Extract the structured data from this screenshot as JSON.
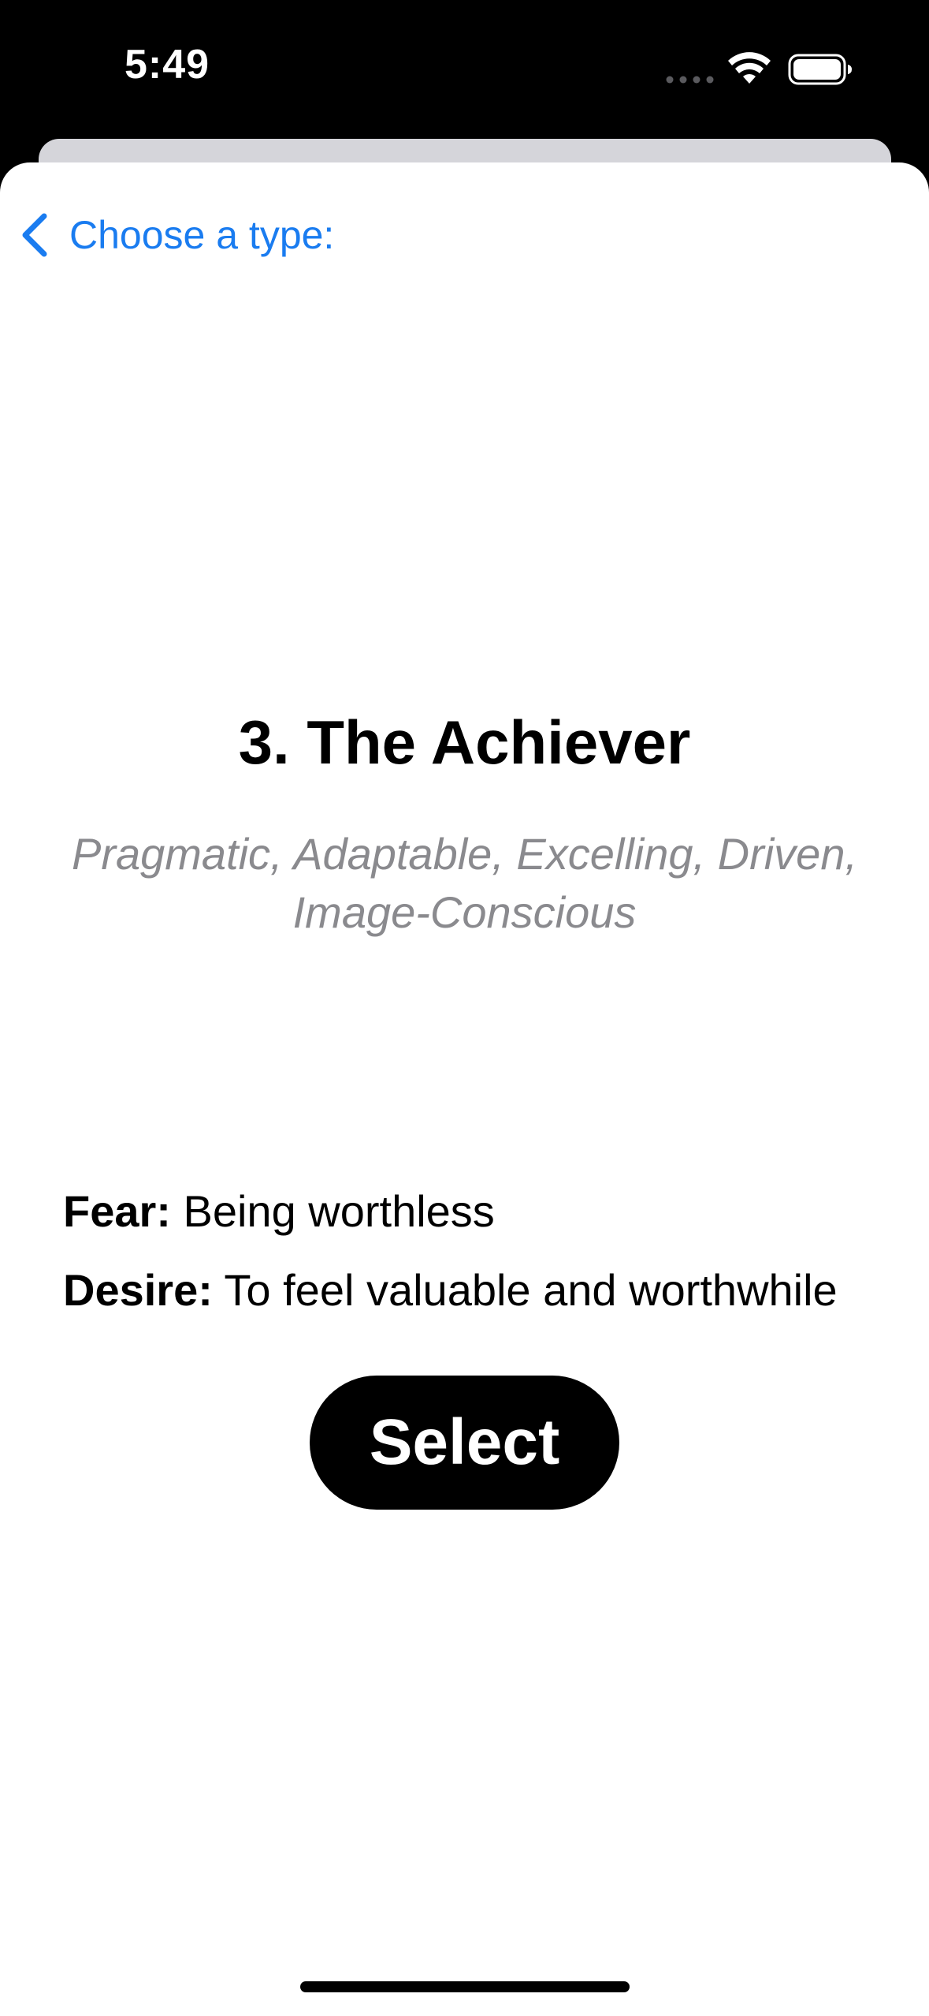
{
  "status_bar": {
    "time": "5:49",
    "icons": [
      "signal-dots-icon",
      "wifi-icon",
      "battery-icon"
    ]
  },
  "nav": {
    "back_label": "Choose a type:",
    "back_icon": "chevron-left-icon"
  },
  "type": {
    "title": "3. The Achiever",
    "traits_line1": "Pragmatic, Adaptable, Excelling, Driven,",
    "traits_line2": "Image-Conscious"
  },
  "details": {
    "fear_label": "Fear:",
    "fear_value": " Being worthless",
    "desire_label": "Desire:",
    "desire_value": " To feel valuable and worthwhile"
  },
  "actions": {
    "select_label": "Select"
  },
  "colors": {
    "accent": "#1a7cf0",
    "secondary_text": "#8a8a8e",
    "button_bg": "#000000",
    "button_text": "#ffffff"
  }
}
